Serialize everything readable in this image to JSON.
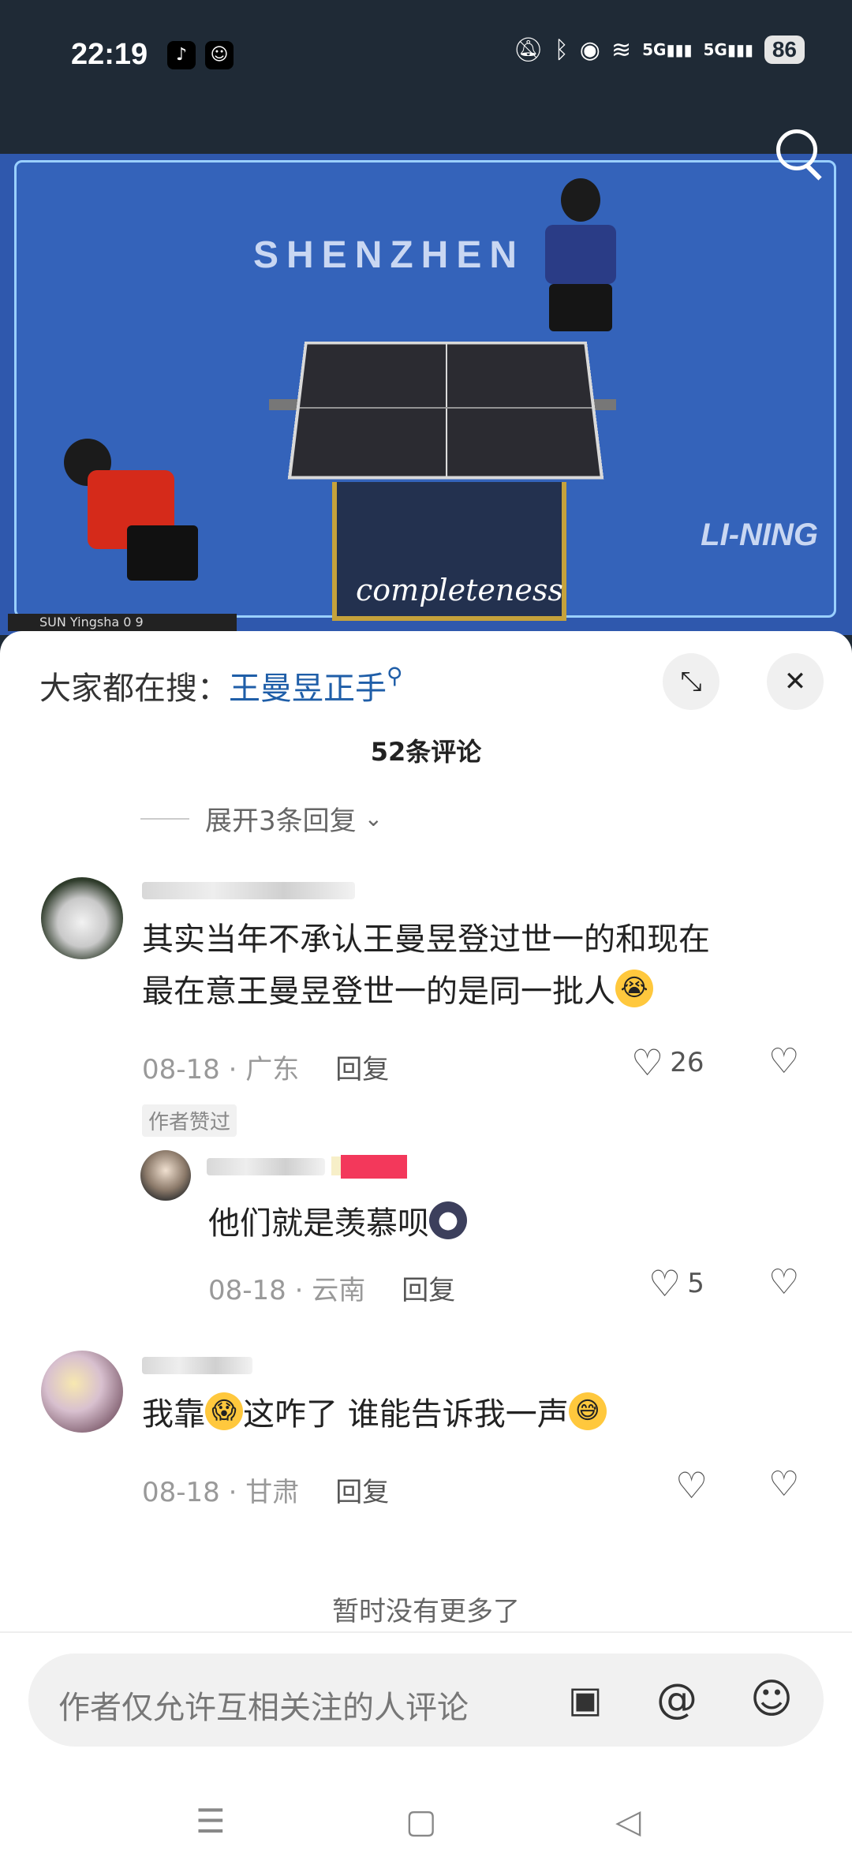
{
  "status_bar": {
    "time": "22:19",
    "battery": "86",
    "signal1": "5G",
    "signal2": "5G"
  },
  "video": {
    "sign_left": "SHENZHEN",
    "sign_right": "LI-NING",
    "caption": "completeness",
    "score_text": "SUN Yingsha  0  9"
  },
  "panel": {
    "hot_search_prefix": "大家都在搜：",
    "hot_search_keyword": "王曼昱正手",
    "comment_count_title": "52条评论",
    "expand_replies": "展开3条回复"
  },
  "comments": [
    {
      "text_line1": "其实当年不承认王曼昱登过世一的和现在",
      "text_line2": "最在意王曼昱登世一的是同一批人",
      "date": "08-18",
      "location": "广东",
      "reply_label": "回复",
      "likes": "26",
      "badge": "作者赞过"
    },
    {
      "text": "他们就是羡慕呗",
      "date": "08-18",
      "location": "云南",
      "reply_label": "回复",
      "likes": "5"
    },
    {
      "text_a": "我靠",
      "text_b": "这咋了 谁能告诉我一声",
      "date": "08-18",
      "location": "甘肃",
      "reply_label": "回复",
      "likes": ""
    }
  ],
  "no_more": "暂时没有更多了",
  "input": {
    "placeholder": "作者仅允许互相关注的人评论"
  },
  "colors": {
    "status_bg": "#1f2a36",
    "keyword": "#1f5ea8",
    "video_bg": "#2f58ad"
  }
}
